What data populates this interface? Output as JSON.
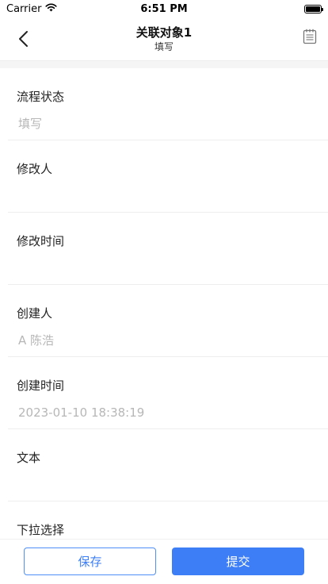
{
  "status_bar": {
    "carrier": "Carrier",
    "time": "6:51 PM"
  },
  "nav": {
    "title": "关联对象1",
    "subtitle": "填写",
    "back_icon": "chevron-left-icon",
    "right_icon": "notebook-icon"
  },
  "fields": [
    {
      "label": "流程状态",
      "value": "填写"
    },
    {
      "label": "修改人",
      "value": ""
    },
    {
      "label": "修改时间",
      "value": ""
    },
    {
      "label": "创建人",
      "value": "A 陈浩"
    },
    {
      "label": "创建时间",
      "value": "2023-01-10 18:38:19"
    },
    {
      "label": "文本",
      "value": ""
    },
    {
      "label": "下拉选择",
      "value": ""
    }
  ],
  "actions": {
    "save_label": "保存",
    "submit_label": "提交"
  },
  "colors": {
    "accent": "#3d7ef6",
    "placeholder": "#b7b7b7"
  }
}
